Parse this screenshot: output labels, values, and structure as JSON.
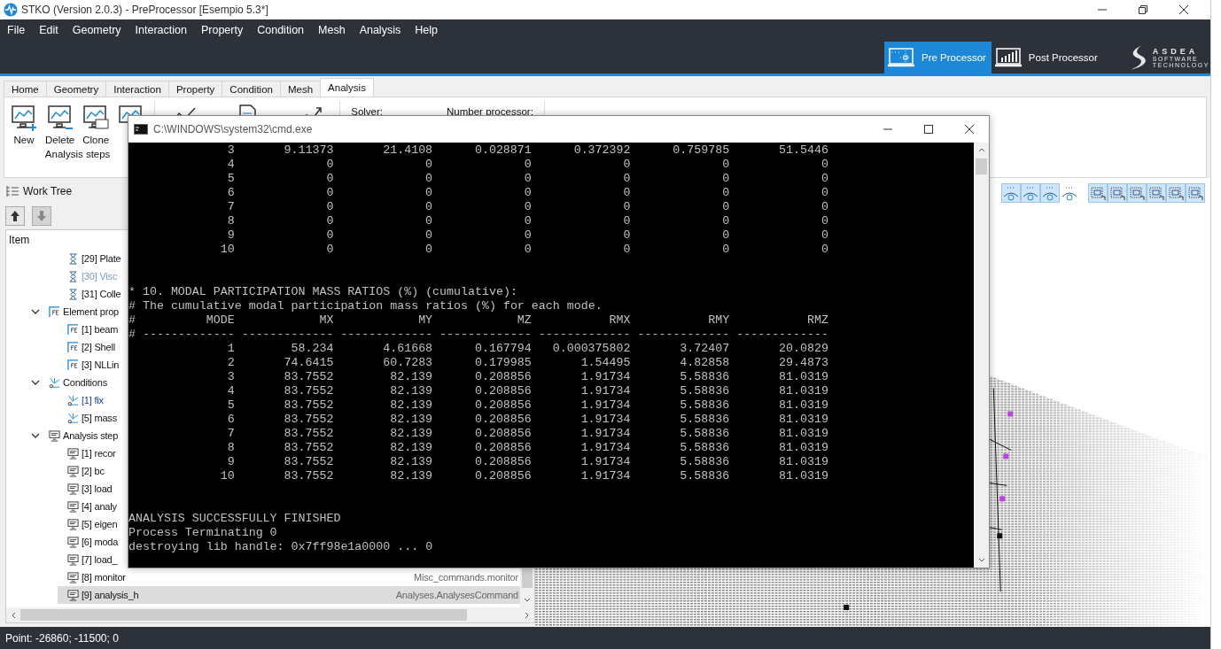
{
  "window": {
    "title": "STKO (Version 2.0.3) - PreProcessor [Esempio 5.3*]"
  },
  "menu": [
    "File",
    "Edit",
    "Geometry",
    "Interaction",
    "Property",
    "Condition",
    "Mesh",
    "Analysis",
    "Help"
  ],
  "modes": [
    {
      "label": "Pre Processor",
      "selected": true
    },
    {
      "label": "Post Processor",
      "selected": false
    }
  ],
  "logo": {
    "name": "ASDEA",
    "lines": [
      "SOFTWARE",
      "TECHNOLOGY"
    ]
  },
  "tabs": [
    {
      "label": "Home",
      "selected": false
    },
    {
      "label": "Geometry",
      "selected": false
    },
    {
      "label": "Interaction",
      "selected": false
    },
    {
      "label": "Property",
      "selected": false
    },
    {
      "label": "Condition",
      "selected": false
    },
    {
      "label": "Mesh",
      "selected": false
    },
    {
      "label": "Analysis",
      "selected": true
    }
  ],
  "ribbon": {
    "group_label": "Analysis steps",
    "buttons": [
      "New",
      "Delete",
      "Clone"
    ],
    "fields": [
      "Solver:",
      "Number processor:"
    ]
  },
  "work_tree": {
    "title": "Work Tree",
    "column": "Item",
    "items": [
      {
        "label": "[29] Plate",
        "kind": "material",
        "selected": false,
        "disabled": false,
        "active": false
      },
      {
        "label": "[30] Visc",
        "kind": "material",
        "selected": false,
        "disabled": true,
        "active": false
      },
      {
        "label": "[31] Colle",
        "kind": "material",
        "selected": false,
        "disabled": false,
        "active": false
      },
      {
        "label": "Element prop",
        "kind": "element",
        "expanded": true,
        "selected": false,
        "children": [
          {
            "label": "[1] beam",
            "kind": "element",
            "selected": false,
            "disabled": false,
            "active": false
          },
          {
            "label": "[2] Shell",
            "kind": "element",
            "selected": false,
            "disabled": false,
            "active": false
          },
          {
            "label": "[3] NLLin",
            "kind": "element",
            "selected": false,
            "disabled": false,
            "active": false
          }
        ]
      },
      {
        "label": "Conditions",
        "kind": "condition",
        "expanded": true,
        "selected": false,
        "children": [
          {
            "label": "[1] fix",
            "kind": "condition",
            "selected": false,
            "disabled": false,
            "active": true
          },
          {
            "label": "[5] mass",
            "kind": "condition",
            "selected": false,
            "disabled": false,
            "active": false
          }
        ]
      },
      {
        "label": "Analysis step",
        "kind": "analysis",
        "expanded": true,
        "selected": false,
        "children": [
          {
            "label": "[1] recor",
            "kind": "analysis",
            "selected": false,
            "disabled": false,
            "active": false
          },
          {
            "label": "[2] bc",
            "kind": "analysis",
            "selected": false,
            "disabled": false,
            "active": false
          },
          {
            "label": "[3] load",
            "kind": "analysis",
            "selected": false,
            "disabled": false,
            "active": false
          },
          {
            "label": "[4] analy",
            "kind": "analysis",
            "selected": false,
            "disabled": false,
            "active": false
          },
          {
            "label": "[5] eigen",
            "kind": "analysis",
            "selected": false,
            "disabled": false,
            "active": false
          },
          {
            "label": "[6] moda",
            "kind": "analysis",
            "selected": false,
            "disabled": false,
            "active": false
          },
          {
            "label": "[7] load_",
            "kind": "analysis",
            "selected": false,
            "disabled": false,
            "active": false
          },
          {
            "label": "[8] monitor",
            "kind": "analysis",
            "type": "Misc_commands.monitor",
            "selected": false,
            "disabled": false,
            "active": false
          },
          {
            "label": "[9] analysis_h",
            "kind": "analysis",
            "type": "Analyses.AnalysesCommand",
            "selected": true,
            "disabled": false,
            "active": false
          }
        ]
      }
    ]
  },
  "viewport": {
    "toolbar_groups": [
      [
        {
          "on": true
        },
        {
          "on": true
        },
        {
          "on": true
        },
        {
          "on": false
        }
      ],
      [
        {
          "on": true
        },
        {
          "on": true
        },
        {
          "on": true
        },
        {
          "on": true
        },
        {
          "on": true
        },
        {
          "on": true
        }
      ]
    ]
  },
  "status_bar": "Point: -26860; -11500; 0",
  "console": {
    "title": "C:\\WINDOWS\\system32\\cmd.exe",
    "top_rows": [
      [
        "3",
        "9.11373",
        "21.4108",
        "0.028871",
        "0.372392",
        "0.759785",
        "51.5446"
      ],
      [
        "4",
        "0",
        "0",
        "0",
        "0",
        "0",
        "0"
      ],
      [
        "5",
        "0",
        "0",
        "0",
        "0",
        "0",
        "0"
      ],
      [
        "6",
        "0",
        "0",
        "0",
        "0",
        "0",
        "0"
      ],
      [
        "7",
        "0",
        "0",
        "0",
        "0",
        "0",
        "0"
      ],
      [
        "8",
        "0",
        "0",
        "0",
        "0",
        "0",
        "0"
      ],
      [
        "9",
        "0",
        "0",
        "0",
        "0",
        "0",
        "0"
      ],
      [
        "10",
        "0",
        "0",
        "0",
        "0",
        "0",
        "0"
      ]
    ],
    "heading": "* 10. MODAL PARTICIPATION MASS RATIOS (%) (cumulative):",
    "comment": "# The cumulative modal participation mass ratios (%) for each mode.",
    "header_mark": "#",
    "columns": [
      "MODE",
      "MX",
      "MY",
      "MZ",
      "RMX",
      "RMY",
      "RMZ"
    ],
    "separator": "# ------------- ------------- ------------- ------------- ------------- ------------- -------------",
    "rows": [
      [
        "1",
        "58.234",
        "4.61668",
        "0.167794",
        "0.000375802",
        "3.72407",
        "20.0829"
      ],
      [
        "2",
        "74.6415",
        "60.7283",
        "0.179985",
        "1.54495",
        "4.82858",
        "29.4873"
      ],
      [
        "3",
        "83.7552",
        "82.139",
        "0.208856",
        "1.91734",
        "5.58836",
        "81.0319"
      ],
      [
        "4",
        "83.7552",
        "82.139",
        "0.208856",
        "1.91734",
        "5.58836",
        "81.0319"
      ],
      [
        "5",
        "83.7552",
        "82.139",
        "0.208856",
        "1.91734",
        "5.58836",
        "81.0319"
      ],
      [
        "6",
        "83.7552",
        "82.139",
        "0.208856",
        "1.91734",
        "5.58836",
        "81.0319"
      ],
      [
        "7",
        "83.7552",
        "82.139",
        "0.208856",
        "1.91734",
        "5.58836",
        "81.0319"
      ],
      [
        "8",
        "83.7552",
        "82.139",
        "0.208856",
        "1.91734",
        "5.58836",
        "81.0319"
      ],
      [
        "9",
        "83.7552",
        "82.139",
        "0.208856",
        "1.91734",
        "5.58836",
        "81.0319"
      ],
      [
        "10",
        "83.7552",
        "82.139",
        "0.208856",
        "1.91734",
        "5.58836",
        "81.0319"
      ]
    ],
    "footer": [
      "ANALYSIS SUCCESSFULLY FINISHED",
      "Process Terminating 0",
      "destroying lib handle: 0x7ff98e1a0000 ... 0"
    ]
  }
}
